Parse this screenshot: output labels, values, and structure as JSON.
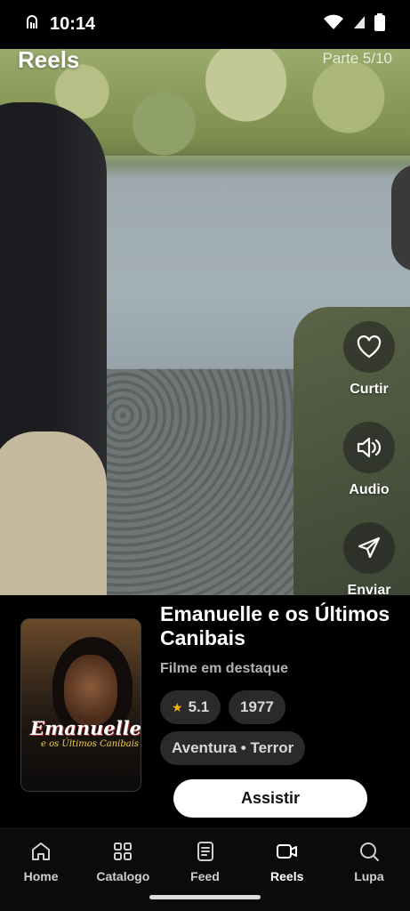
{
  "status_bar": {
    "time": "10:14"
  },
  "header": {
    "title": "Reels",
    "part": "Parte 5/10"
  },
  "actions": [
    {
      "label": "Curtir",
      "icon": "heart-icon"
    },
    {
      "label": "Audio",
      "icon": "speaker-icon"
    },
    {
      "label": "Enviar",
      "icon": "send-icon"
    }
  ],
  "movie": {
    "title": "Emanuelle e os Últimos Canibais",
    "subtitle": "Filme em destaque",
    "rating": "5.1",
    "year": "1977",
    "genres": "Aventura • Terror",
    "poster_title": "Emanuelle",
    "poster_subtitle": "e os Últimos Canibais",
    "watch_label": "Assistir"
  },
  "nav": [
    {
      "label": "Home",
      "icon": "home-icon"
    },
    {
      "label": "Catalogo",
      "icon": "grid-icon"
    },
    {
      "label": "Feed",
      "icon": "feed-icon"
    },
    {
      "label": "Reels",
      "icon": "video-icon",
      "active": true
    },
    {
      "label": "Lupa",
      "icon": "search-icon"
    }
  ],
  "colors": {
    "accent": "#ffffff",
    "star": "#f4b400",
    "chip_bg": "#2a2a2a"
  }
}
